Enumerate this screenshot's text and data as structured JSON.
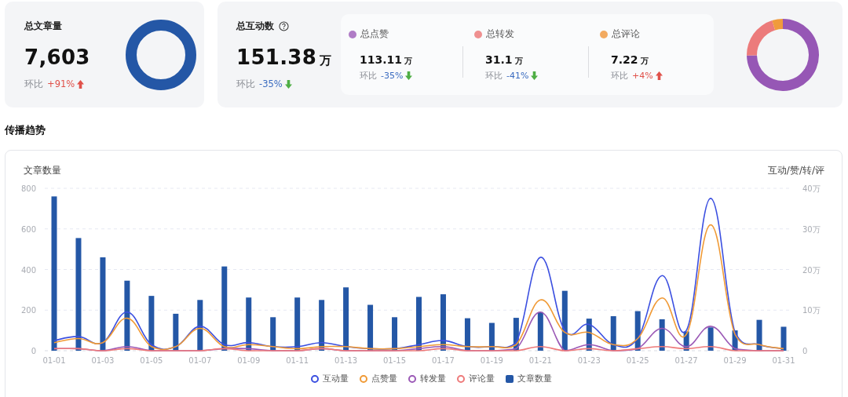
{
  "article_card": {
    "title": "总文章量",
    "value": "7,603",
    "change_label": "环比",
    "change": "+91%",
    "up": true
  },
  "interaction_card": {
    "title": "总互动数",
    "value": "151.38",
    "unit": "万",
    "change_label": "环比",
    "change": "-35%",
    "up": false,
    "metrics": [
      {
        "name": "总点赞",
        "color": "#b07cc6",
        "value": "113.11",
        "unit": "万",
        "change_label": "环比",
        "change": "-35%",
        "up": false
      },
      {
        "name": "总转发",
        "color": "#ef9090",
        "value": "31.1",
        "unit": "万",
        "change_label": "环比",
        "change": "-41%",
        "up": false
      },
      {
        "name": "总评论",
        "color": "#f2aa60",
        "value": "7.22",
        "unit": "万",
        "change_label": "环比",
        "change": "+4%",
        "up": true
      }
    ],
    "chart_data": {
      "type": "donut",
      "values": [
        74.7,
        20.5,
        4.8
      ],
      "colors": [
        "#9657b5",
        "#ec7b7b",
        "#f09b3c"
      ]
    }
  },
  "section_title": "传播趋势",
  "trend_chart": {
    "chart_data": {
      "type": "bar",
      "grid": true,
      "legend": true,
      "ylabel": "文章数量",
      "y2label": "互动/赞/转/评",
      "categories": [
        "01-01",
        null,
        "01-03",
        null,
        "01-05",
        null,
        "01-07",
        null,
        "01-09",
        null,
        "01-11",
        null,
        "01-13",
        null,
        "01-15",
        null,
        "01-17",
        null,
        "01-19",
        null,
        "01-21",
        null,
        "01-23",
        null,
        "01-25",
        null,
        "01-27",
        null,
        "01-29",
        null,
        "01-31"
      ],
      "ylim": [
        0,
        800
      ],
      "yticks": [
        0,
        200,
        400,
        600,
        800
      ],
      "y2lim": [
        0,
        40
      ],
      "y2ticks": [
        {
          "value": 0,
          "label": "0"
        },
        {
          "value": 10,
          "label": "10万"
        },
        {
          "value": 20,
          "label": "20万"
        },
        {
          "value": 30,
          "label": "30万"
        },
        {
          "value": 40,
          "label": "40万"
        }
      ],
      "series": [
        {
          "name": "互动量",
          "type": "line",
          "axis": "y2",
          "color": "#3b4fe0",
          "values": [
            2.5,
            3.5,
            2,
            9.5,
            1.5,
            1,
            6,
            1.5,
            2,
            1,
            1,
            2,
            1,
            0.5,
            0.5,
            1.5,
            2.5,
            1,
            1,
            2,
            23,
            5,
            6.5,
            1.5,
            3,
            18.5,
            5,
            37.5,
            4.5,
            1.5,
            0.5
          ]
        },
        {
          "name": "点赞量",
          "type": "line",
          "axis": "y2",
          "color": "#f09a36",
          "values": [
            2,
            3,
            2,
            8,
            1,
            1,
            5.5,
            1,
            1.5,
            1,
            0.5,
            1,
            1,
            0.5,
            0.5,
            1,
            1.5,
            1,
            1,
            1.5,
            12.5,
            4.5,
            4.5,
            1.5,
            3,
            13,
            4,
            31,
            4,
            1.5,
            0.5
          ]
        },
        {
          "name": "转发量",
          "type": "line",
          "axis": "y2",
          "color": "#9b59b6",
          "values": [
            0.5,
            0.5,
            0,
            1,
            0,
            0,
            0,
            0.5,
            0.5,
            0,
            0,
            0.5,
            0,
            0,
            0,
            0.5,
            1,
            0,
            0,
            0.5,
            9.5,
            0,
            1.5,
            0,
            0.5,
            5.5,
            1,
            6,
            0.5,
            0,
            0
          ]
        },
        {
          "name": "评论量",
          "type": "line",
          "axis": "y2",
          "color": "#ee7a7a",
          "values": [
            0.5,
            0.5,
            0,
            0.5,
            0,
            0,
            0,
            0.5,
            0,
            0,
            0,
            0.5,
            0,
            0,
            0,
            0,
            0.5,
            0,
            0,
            0,
            1,
            0,
            0.5,
            0,
            0.5,
            1,
            0.5,
            1,
            0,
            0,
            0
          ]
        },
        {
          "name": "文章数量",
          "color": "#2457a6",
          "values": [
            760,
            555,
            460,
            345,
            270,
            182,
            250,
            415,
            262,
            165,
            262,
            250,
            312,
            226,
            165,
            265,
            278,
            160,
            137,
            162,
            190,
            295,
            158,
            170,
            195,
            155,
            95,
            115,
            100,
            152,
            118
          ]
        }
      ]
    }
  }
}
